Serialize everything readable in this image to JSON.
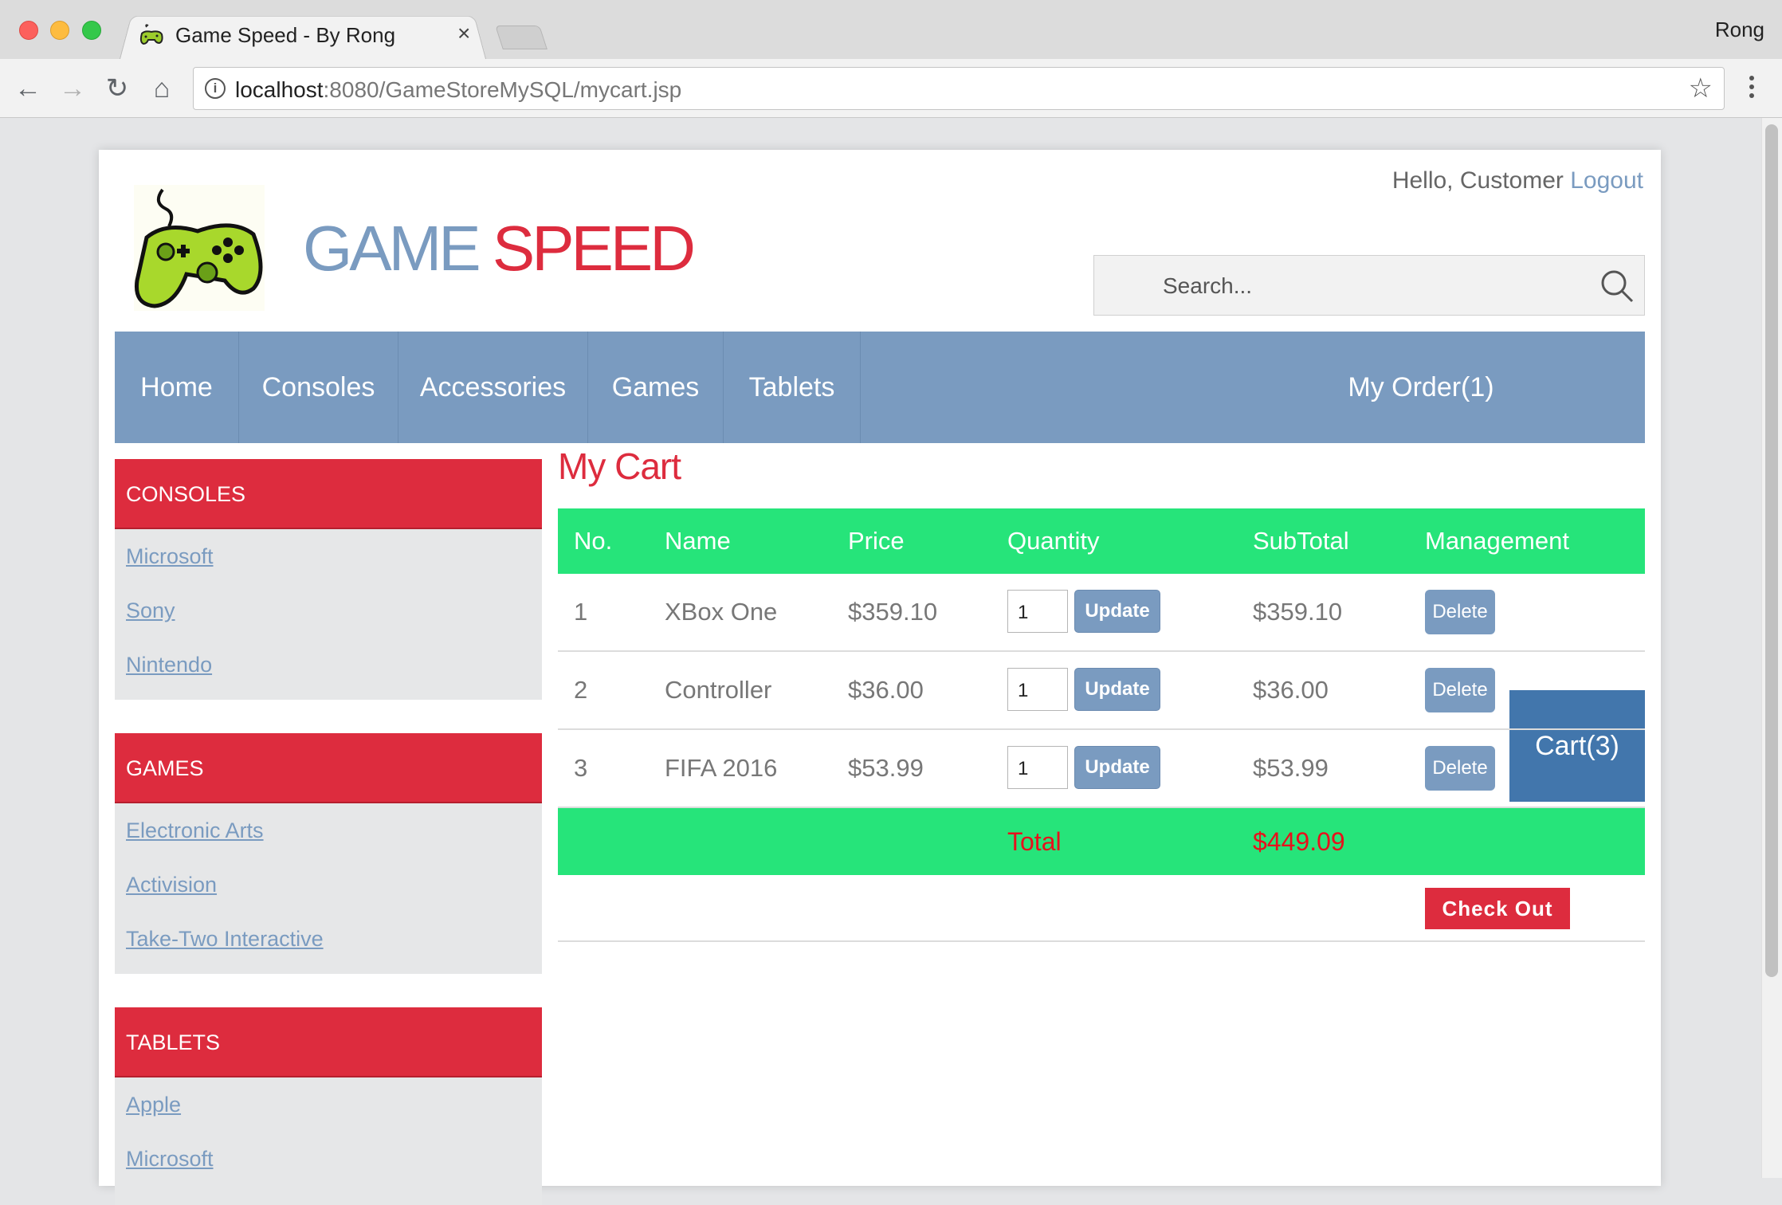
{
  "browser": {
    "tab_title": "Game Speed - By Rong",
    "tab_close": "×",
    "profile": "Rong",
    "url_host": "localhost",
    "url_path": ":8080/GameStoreMySQL/mycart.jsp",
    "back_icon": "←",
    "forward_icon": "→",
    "reload_icon": "↻",
    "home_icon": "⌂",
    "info_icon": "i",
    "star_icon": "☆"
  },
  "header": {
    "brand_part1": "GAME",
    "brand_part2": "SPEED",
    "hello": "Hello, Customer",
    "logout": "Logout",
    "search_placeholder": "Search..."
  },
  "nav": {
    "items": [
      "Home",
      "Consoles",
      "Accessories",
      "Games",
      "Tablets"
    ],
    "my_order": "My Order(1)",
    "cart": "Cart(3)"
  },
  "sidebar": {
    "sections": [
      {
        "title": "CONSOLES",
        "links": [
          "Microsoft",
          "Sony",
          "Nintendo"
        ]
      },
      {
        "title": "GAMES",
        "links": [
          "Electronic Arts",
          "Activision",
          "Take-Two Interactive"
        ]
      },
      {
        "title": "TABLETS",
        "links": [
          "Apple",
          "Microsoft"
        ]
      }
    ]
  },
  "cart": {
    "title": "My Cart",
    "columns": [
      "No.",
      "Name",
      "Price",
      "Quantity",
      "SubTotal",
      "Management"
    ],
    "rows": [
      {
        "no": "1",
        "name": "XBox One",
        "price": "$359.10",
        "qty": "1",
        "subtotal": "$359.10"
      },
      {
        "no": "2",
        "name": "Controller",
        "price": "$36.00",
        "qty": "1",
        "subtotal": "$36.00"
      },
      {
        "no": "3",
        "name": "FIFA 2016",
        "price": "$53.99",
        "qty": "1",
        "subtotal": "$53.99"
      }
    ],
    "update_label": "Update",
    "delete_label": "Delete",
    "total_label": "Total",
    "total_value": "$449.09",
    "checkout_label": "Check Out"
  },
  "colors": {
    "brand_blue": "#7a9bc0",
    "brand_red": "#dd2c3e",
    "table_green": "#26e47a",
    "cart_active": "#4276ac"
  }
}
